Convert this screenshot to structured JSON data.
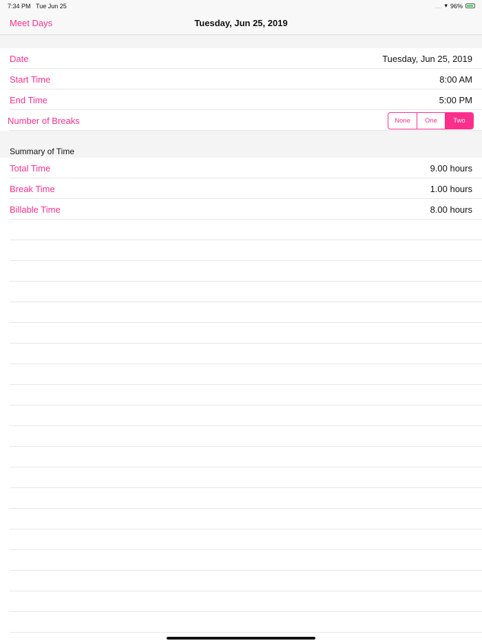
{
  "status": {
    "time": "7:34 PM",
    "date": "Tue Jun 25",
    "battery": "96%"
  },
  "nav": {
    "back": "Meet Days",
    "title": "Tuesday, Jun 25, 2019"
  },
  "details": [
    {
      "label": "Date",
      "value": "Tuesday, Jun 25, 2019"
    },
    {
      "label": "Start Time",
      "value": "8:00 AM"
    },
    {
      "label": "End Time",
      "value": "5:00 PM"
    }
  ],
  "breaks": {
    "label": "Number of Breaks",
    "options": [
      "None",
      "One",
      "Two"
    ],
    "selected": "Two"
  },
  "summary": {
    "header": "Summary of Time",
    "rows": [
      {
        "label": "Total Time",
        "value": "9.00 hours"
      },
      {
        "label": "Break Time",
        "value": "1.00 hours"
      },
      {
        "label": "Billable Time",
        "value": "8.00 hours"
      }
    ]
  },
  "colors": {
    "accent": "#fc2e8c"
  }
}
